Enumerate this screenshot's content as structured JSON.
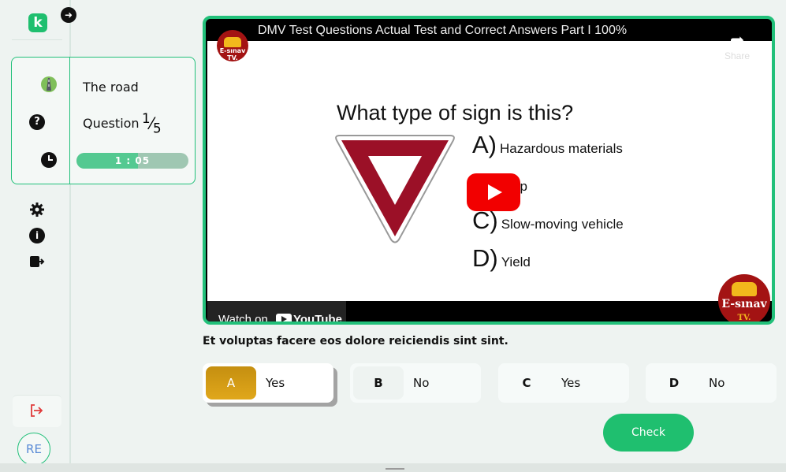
{
  "sidebar": {
    "logo_letter": "k",
    "collapse_icon": "arrow-right-icon",
    "nav_icons": [
      "road-icon",
      "question-icon",
      "clock-icon"
    ],
    "util_icons": [
      "gear-icon",
      "info-icon",
      "logout-icon"
    ],
    "exit_icon": "exit-icon",
    "avatar_initials": "RE"
  },
  "lesson_panel": {
    "topic": "The road",
    "question_label": "Question",
    "question_current": "1",
    "question_total": "5",
    "timer": "1 : 05",
    "timer_progress": 0.55
  },
  "video": {
    "title": "DMV Test Questions Actual Test and Correct Answers Part I 100%",
    "channel_badge": "E-sınav TV.",
    "share_label": "Share",
    "heading": "What type of sign is this?",
    "options": [
      {
        "letter": "A)",
        "text": "Hazardous materials"
      },
      {
        "letter": "B)",
        "text": "Stop"
      },
      {
        "letter": "C)",
        "text": "Slow-moving vehicle"
      },
      {
        "letter": "D)",
        "text": "Yield"
      }
    ],
    "watch_on": "Watch on",
    "youtube": "YouTube",
    "brand_text": "E-sınav",
    "brand_sub": "TV."
  },
  "question": {
    "text": "Et voluptas facere eos dolore reiciendis sint sint."
  },
  "answers": [
    {
      "key": "A",
      "value": "Yes",
      "selected": true
    },
    {
      "key": "B",
      "value": "No",
      "selected": false
    },
    {
      "key": "C",
      "value": "Yes",
      "selected": false
    },
    {
      "key": "D",
      "value": "No",
      "selected": false
    }
  ],
  "check_label": "Check",
  "colors": {
    "accent": "#1fbf6f",
    "selected_answer": "#d49c15",
    "video_border": "#22c07a"
  }
}
